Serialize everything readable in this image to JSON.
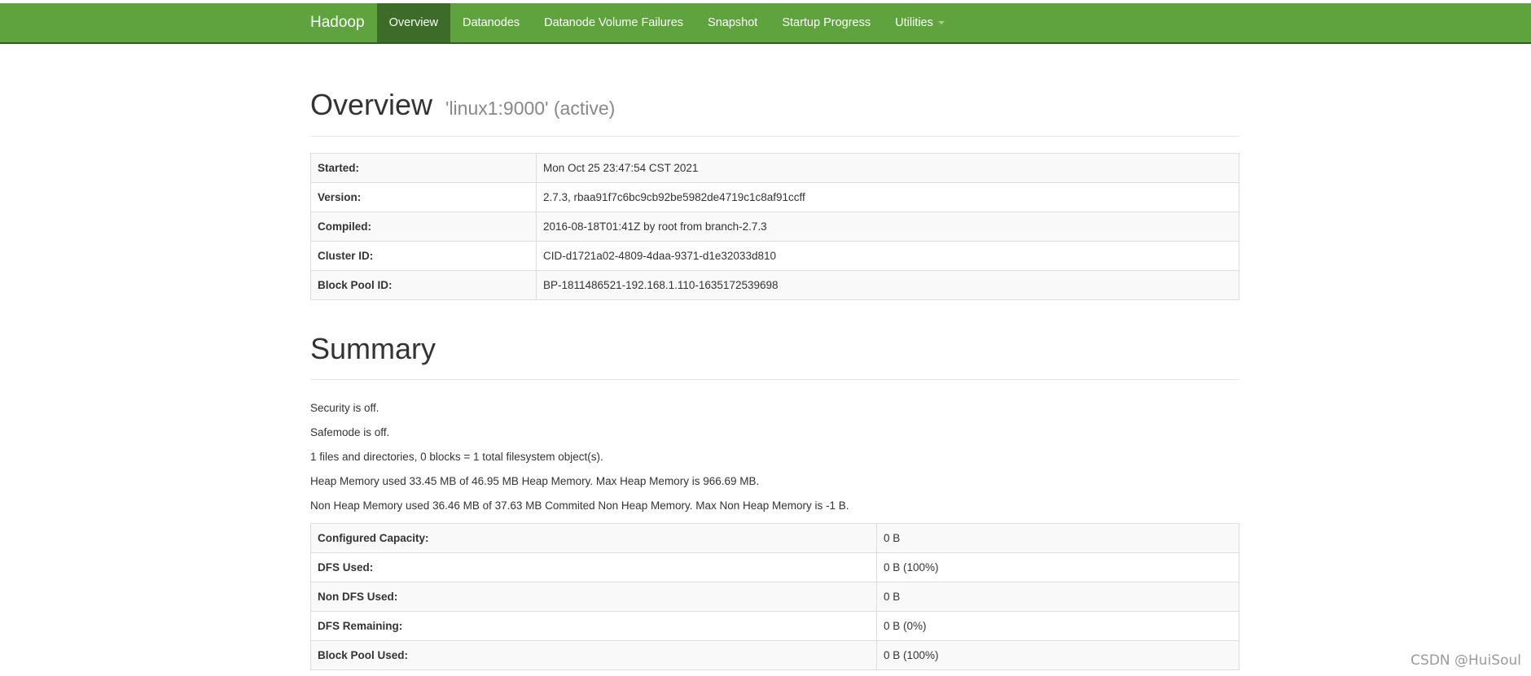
{
  "navbar": {
    "brand": "Hadoop",
    "items": [
      {
        "label": "Overview",
        "active": true
      },
      {
        "label": "Datanodes",
        "active": false
      },
      {
        "label": "Datanode Volume Failures",
        "active": false
      },
      {
        "label": "Snapshot",
        "active": false
      },
      {
        "label": "Startup Progress",
        "active": false
      },
      {
        "label": "Utilities",
        "active": false
      }
    ]
  },
  "overview": {
    "title": "Overview",
    "subtitle": "'linux1:9000' (active)",
    "rows": [
      {
        "key": "Started:",
        "value": "Mon Oct 25 23:47:54 CST 2021"
      },
      {
        "key": "Version:",
        "value": "2.7.3, rbaa91f7c6bc9cb92be5982de4719c1c8af91ccff"
      },
      {
        "key": "Compiled:",
        "value": "2016-08-18T01:41Z by root from branch-2.7.3"
      },
      {
        "key": "Cluster ID:",
        "value": "CID-d1721a02-4809-4daa-9371-d1e32033d810"
      },
      {
        "key": "Block Pool ID:",
        "value": "BP-1811486521-192.168.1.110-1635172539698"
      }
    ]
  },
  "summary": {
    "title": "Summary",
    "lines": [
      "Security is off.",
      "Safemode is off.",
      "1 files and directories, 0 blocks = 1 total filesystem object(s).",
      "Heap Memory used 33.45 MB of 46.95 MB Heap Memory. Max Heap Memory is 966.69 MB.",
      "Non Heap Memory used 36.46 MB of 37.63 MB Commited Non Heap Memory. Max Non Heap Memory is -1 B."
    ],
    "rows": [
      {
        "key": "Configured Capacity:",
        "value": "0 B"
      },
      {
        "key": "DFS Used:",
        "value": "0 B (100%)"
      },
      {
        "key": "Non DFS Used:",
        "value": "0 B"
      },
      {
        "key": "DFS Remaining:",
        "value": "0 B (0%)"
      },
      {
        "key": "Block Pool Used:",
        "value": "0 B (100%)"
      }
    ]
  },
  "watermark": "CSDN @HuiSoul",
  "colors": {
    "navbar": "#5fa33e",
    "navbar_active": "#3d6b28"
  }
}
